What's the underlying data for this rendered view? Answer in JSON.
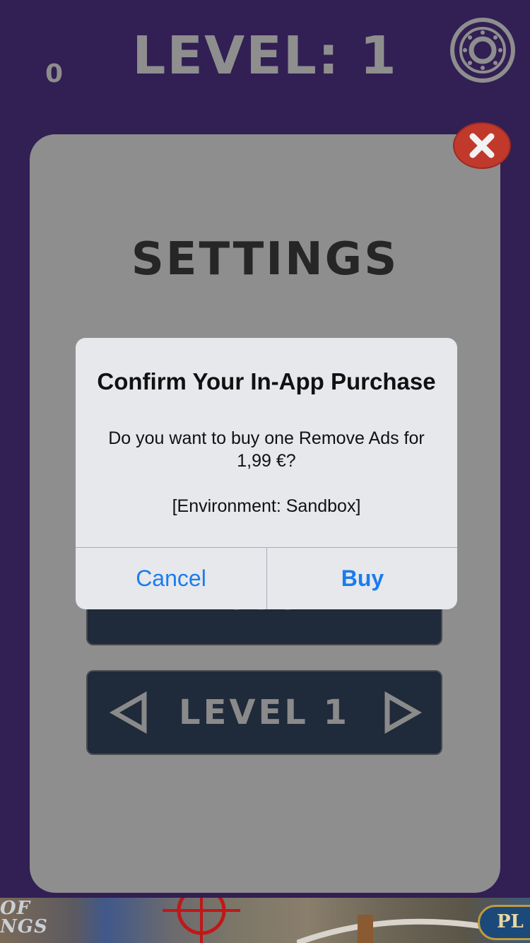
{
  "header": {
    "score": "0",
    "level_title": "LEVEL: 1",
    "gear_icon": "gear-icon"
  },
  "settings": {
    "title": "SETTINGS",
    "close_icon": "close-icon",
    "restore_label": "RESTORE",
    "level_selector_label": "LEVEL 1",
    "prev_icon": "triangle-left-icon",
    "next_icon": "triangle-right-icon"
  },
  "alert": {
    "title": "Confirm Your In-App Purchase",
    "message": "Do you want to buy one Remove Ads for 1,99 €?\n\n[Environment: Sandbox]",
    "cancel_label": "Cancel",
    "buy_label": "Buy"
  },
  "ad_banner": {
    "logo_text": "OF\nNGS",
    "button_label": "PL"
  },
  "colors": {
    "background": "#321f54",
    "panel": "#8e8e8e",
    "dark_button": "#1f2a3a",
    "close_red": "#c0392b",
    "alert_bg": "#e6e8ec",
    "ios_blue": "#1a7cf0"
  }
}
